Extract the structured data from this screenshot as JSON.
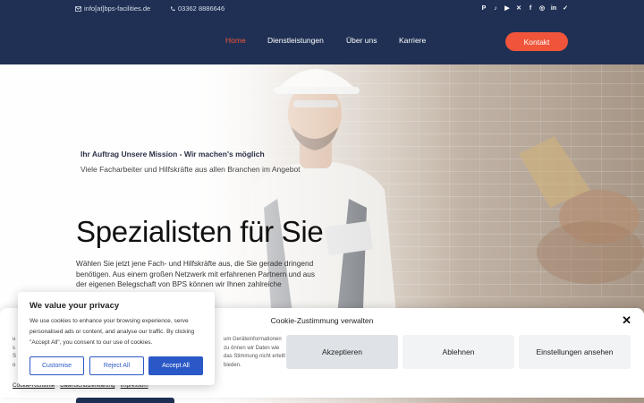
{
  "topbar": {
    "email": "info[at]bps-facilities.de",
    "phone": "03362 8886646",
    "social_icons": [
      "pinterest-icon",
      "tiktok-icon",
      "youtube-icon",
      "x-icon",
      "facebook-icon",
      "instagram-icon",
      "linkedin-icon",
      "check-icon"
    ]
  },
  "nav": {
    "items": [
      {
        "label": "Home",
        "active": true
      },
      {
        "label": "Dienstleistungen"
      },
      {
        "label": "Über uns"
      },
      {
        "label": "Karriere"
      }
    ],
    "contact_label": "Kontakt"
  },
  "hero": {
    "eyebrow": "Ihr Auftrag Unsere Mission - Wir machen's möglich",
    "subtitle": "Viele Facharbeiter und Hilfskräfte aus allen Branchen im Angebot",
    "headline": "Spezialisten für Sie",
    "lead": "Wählen Sie jetzt jene Fach- und Hilfskräfte aus, die Sie gerade dringend benötigen. Aus einem großen Netzwerk mit erfahrenen Partnern und aus der eigenen Belegschaft von BPS können wir Ihnen zahlreiche Arbeitskräfte"
  },
  "cookie_bar": {
    "title": "Cookie-Zustimmung verwalten",
    "text_left_fragments": [
      "u",
      "s",
      "S",
      "o"
    ],
    "text_right": "um Geräteinformationen zu önnen wir Daten wie das Stimmung nicht erteilt bieden.",
    "accept_label": "Akzeptieren",
    "deny_label": "Ablehnen",
    "settings_label": "Einstellungen ansehen",
    "links": [
      "Cookie-Richtlinie",
      "Datenschutzerklärung",
      "Impressum"
    ]
  },
  "popup": {
    "title": "We value your privacy",
    "text": "We use cookies to enhance your browsing experience, serve personalised ads or content, and analyse our traffic. By clicking \"Accept All\", you consent to our use of cookies.",
    "customise_label": "Customise",
    "reject_label": "Reject All",
    "accept_label": "Accept All"
  },
  "colors": {
    "header_bg": "#1f3054",
    "accent": "#f0553b",
    "popup_blue": "#2b58c7"
  }
}
